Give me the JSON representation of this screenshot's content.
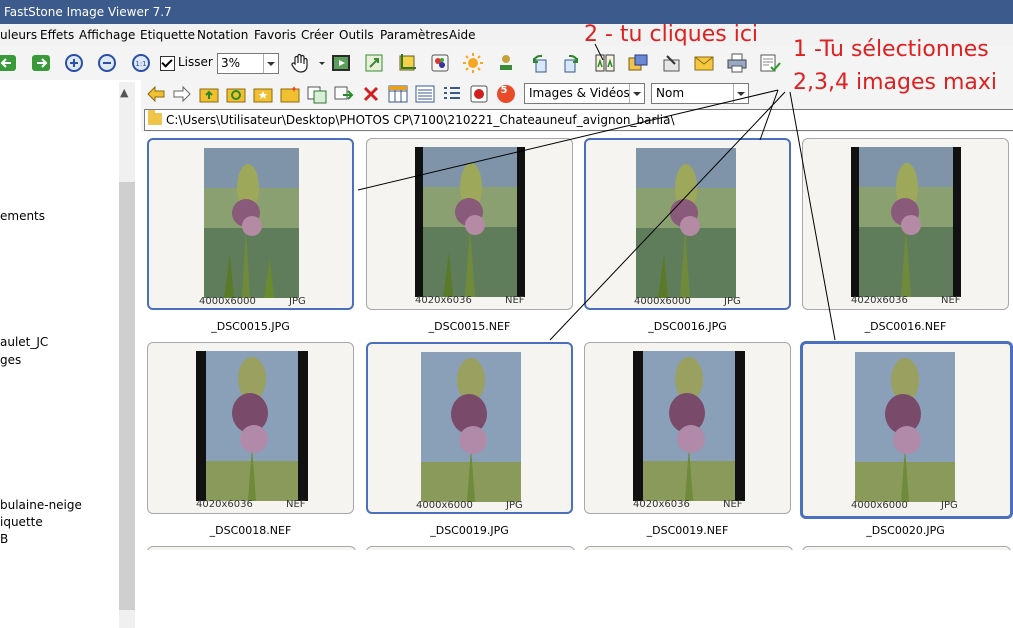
{
  "window": {
    "title": "FastStone Image Viewer 7.7"
  },
  "menu": [
    "uleurs",
    "Effets",
    "Affichage",
    "Etiquette",
    "Notation",
    "Favoris",
    "Créer",
    "Outils",
    "Paramètres",
    "Aide"
  ],
  "toolbar": {
    "smooth_label": "Lisser",
    "smooth_checked": true,
    "zoom_value": "3%"
  },
  "filter": {
    "type_value": "Images & Vidéos",
    "sort_value": "Nom",
    "badge_count": "5"
  },
  "path": "C:\\Users\\Utilisateur\\Desktop\\PHOTOS CP\\7100\\210221_Chateauneuf_avignon_barlia\\",
  "sidebar": {
    "items": [
      "ements",
      "aulet_JC",
      "ges",
      "bulaine-neige",
      "iquette",
      "B"
    ]
  },
  "thumbnails": [
    {
      "name": "_DSC0015.JPG",
      "dims": "4000x6000",
      "format": "JPG",
      "selected": true
    },
    {
      "name": "_DSC0015.NEF",
      "dims": "4020x6036",
      "format": "NEF",
      "selected": false
    },
    {
      "name": "_DSC0016.JPG",
      "dims": "4000x6000",
      "format": "JPG",
      "selected": true
    },
    {
      "name": "_DSC0016.NEF",
      "dims": "4020x6036",
      "format": "NEF",
      "selected": false
    },
    {
      "name": "_DSC0018.NEF",
      "dims": "4020x6036",
      "format": "NEF",
      "selected": false
    },
    {
      "name": "_DSC0019.JPG",
      "dims": "4000x6000",
      "format": "JPG",
      "selected": true
    },
    {
      "name": "_DSC0019.NEF",
      "dims": "4020x6036",
      "format": "NEF",
      "selected": false
    },
    {
      "name": "_DSC0020.JPG",
      "dims": "4000x6000",
      "format": "JPG",
      "selected": true
    }
  ],
  "annotations": {
    "click_here": "2 - tu cliques ici",
    "select_line1": "1 -Tu sélectionnes",
    "select_line2": "2,3,4 images maxi",
    "color": "#e02020"
  },
  "colors": {
    "selection_border": "#4a6fbd",
    "titlebar": "#3c5a8c"
  }
}
